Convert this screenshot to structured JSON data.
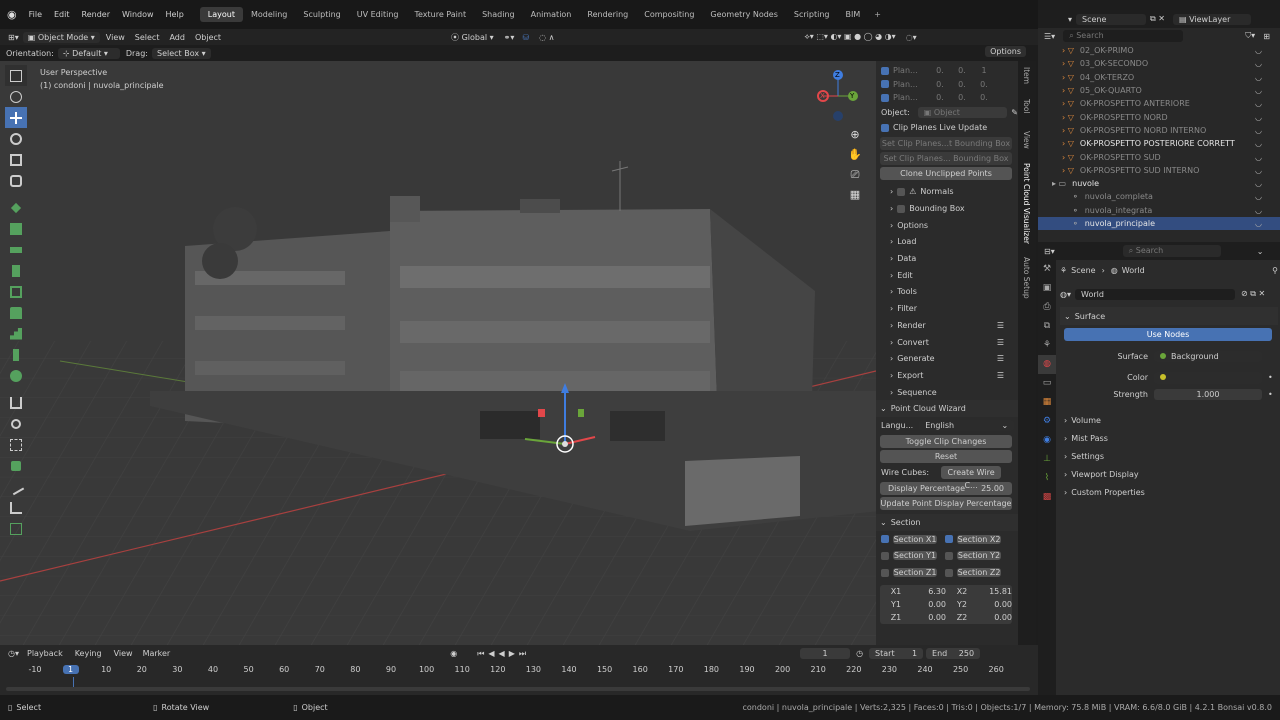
{
  "menu": [
    "File",
    "Edit",
    "Render",
    "Window",
    "Help"
  ],
  "workspaces": [
    "Layout",
    "Modeling",
    "Sculpting",
    "UV Editing",
    "Texture Paint",
    "Shading",
    "Animation",
    "Rendering",
    "Compositing",
    "Geometry Nodes",
    "Scripting",
    "BIM"
  ],
  "add_tab": "+",
  "scene": "Scene",
  "view_layer": "ViewLayer",
  "header": {
    "mode": "Object Mode",
    "view": "View",
    "select": "Select",
    "add": "Add",
    "object": "Object",
    "transform": "Global",
    "options": "Options"
  },
  "orientation": {
    "label": "Orientation:",
    "value": "Default",
    "drag_label": "Drag:",
    "drag_value": "Select Box"
  },
  "viewport": {
    "title": "User Perspective",
    "subtitle": "(1) condoni | nuvola_principale",
    "gizmo_x": "X",
    "gizmo_y": "Y",
    "gizmo_z": "Z"
  },
  "npanel": {
    "plane_rows": [
      {
        "label": "Plan...",
        "v": [
          "0.",
          "0.",
          "1"
        ]
      },
      {
        "label": "Plan...",
        "v": [
          "0.",
          "0.",
          "0."
        ]
      },
      {
        "label": "Plan...",
        "v": [
          "0.",
          "0.",
          "0."
        ]
      }
    ],
    "object_label": "Object:",
    "object_placeholder": "Object",
    "clip_live": "Clip Planes Live Update",
    "set_clip1": "Set Clip Planes...t Bounding Box",
    "set_clip2": "Set Clip Planes... Bounding Box",
    "clone_unclipped": "Clone Unclipped Points",
    "sections": [
      "Normals",
      "Bounding Box",
      "Options",
      "Load",
      "Data",
      "Edit",
      "Tools",
      "Filter",
      "Render",
      "Convert",
      "Generate",
      "Export",
      "Sequence"
    ],
    "wizard_title": "Point Cloud Wizard",
    "lang_label": "Langu...",
    "lang_value": "English",
    "toggle_clip": "Toggle Clip Changes",
    "reset": "Reset",
    "wire_label": "Wire Cubes:",
    "wire_btn": "Create Wire C...",
    "display_pct_label": "Display Percentage",
    "display_pct_value": "25.00",
    "update_pct": "Update Point Display Percentage",
    "section_title": "Section",
    "section_buttons": [
      [
        "Section X1",
        "Section X2"
      ],
      [
        "Section Y1",
        "Section Y2"
      ],
      [
        "Section Z1",
        "Section Z2"
      ]
    ],
    "coords": [
      [
        "X1",
        "6.30",
        "X2",
        "15.81"
      ],
      [
        "Y1",
        "0.00",
        "Y2",
        "0.00"
      ],
      [
        "Z1",
        "0.00",
        "Z2",
        "0.00"
      ]
    ]
  },
  "ntabs": [
    "Item",
    "Tool",
    "View",
    "Point Cloud Visualizer",
    "Auto Setup"
  ],
  "outliner": {
    "search": "Search",
    "items": [
      {
        "name": "02_OK-PRIMO",
        "indent": 1,
        "dim": true
      },
      {
        "name": "03_OK-SECONDO",
        "indent": 1,
        "dim": true
      },
      {
        "name": "04_OK-TERZO",
        "indent": 1,
        "dim": true
      },
      {
        "name": "05_OK-QUARTO",
        "indent": 1,
        "dim": true
      },
      {
        "name": "OK-PROSPETTO ANTERIORE",
        "indent": 1,
        "dim": true
      },
      {
        "name": "OK-PROSPETTO NORD",
        "indent": 1,
        "dim": true
      },
      {
        "name": "OK-PROSPETTO NORD INTERNO",
        "indent": 1,
        "dim": true
      },
      {
        "name": "OK-PROSPETTO POSTERIORE CORRETT",
        "indent": 1,
        "dim": false
      },
      {
        "name": "OK-PROSPETTO SUD",
        "indent": 1,
        "dim": true
      },
      {
        "name": "OK-PROSPETTO SUD INTERNO",
        "indent": 1,
        "dim": true
      },
      {
        "name": "nuvole",
        "indent": 0,
        "dim": false
      },
      {
        "name": "nuvola_completa",
        "indent": 2,
        "dim": true
      },
      {
        "name": "nuvola_integrata",
        "indent": 2,
        "dim": true
      },
      {
        "name": "nuvola_principale",
        "indent": 2,
        "dim": false
      }
    ]
  },
  "properties": {
    "search": "Search",
    "scene": "Scene",
    "world": "World",
    "world_field": "World",
    "surface": "Surface",
    "use_nodes": "Use Nodes",
    "surface_label": "Surface",
    "surface_value": "Background",
    "color_label": "Color",
    "strength_label": "Strength",
    "strength_value": "1.000",
    "panels": [
      "Volume",
      "Mist Pass",
      "Settings",
      "Viewport Display",
      "Custom Properties"
    ]
  },
  "timeline": {
    "playback": "Playback",
    "keying": "Keying",
    "view": "View",
    "marker": "Marker",
    "current_frame": "1",
    "start_label": "Start",
    "start": "1",
    "end_label": "End",
    "end": "250",
    "ticks": [
      "-10",
      "1",
      "10",
      "20",
      "30",
      "40",
      "50",
      "60",
      "70",
      "80",
      "90",
      "100",
      "110",
      "120",
      "130",
      "140",
      "150",
      "160",
      "170",
      "180",
      "190",
      "200",
      "210",
      "220",
      "230",
      "240",
      "250",
      "260"
    ]
  },
  "status": {
    "select": "Select",
    "rotate": "Rotate View",
    "object": "Object",
    "info": "condoni | nuvola_principale | Verts:2,325 | Faces:0 | Tris:0 | Objects:1/7 | Memory: 75.8 MiB | VRAM: 6.6/8.0 GiB | 4.2.1 Bonsai v0.8.0"
  },
  "colors": {
    "accent": "#4772b3",
    "x_axis": "#e2474a",
    "y_axis": "#6aa53a",
    "z_axis": "#3f7de0"
  }
}
